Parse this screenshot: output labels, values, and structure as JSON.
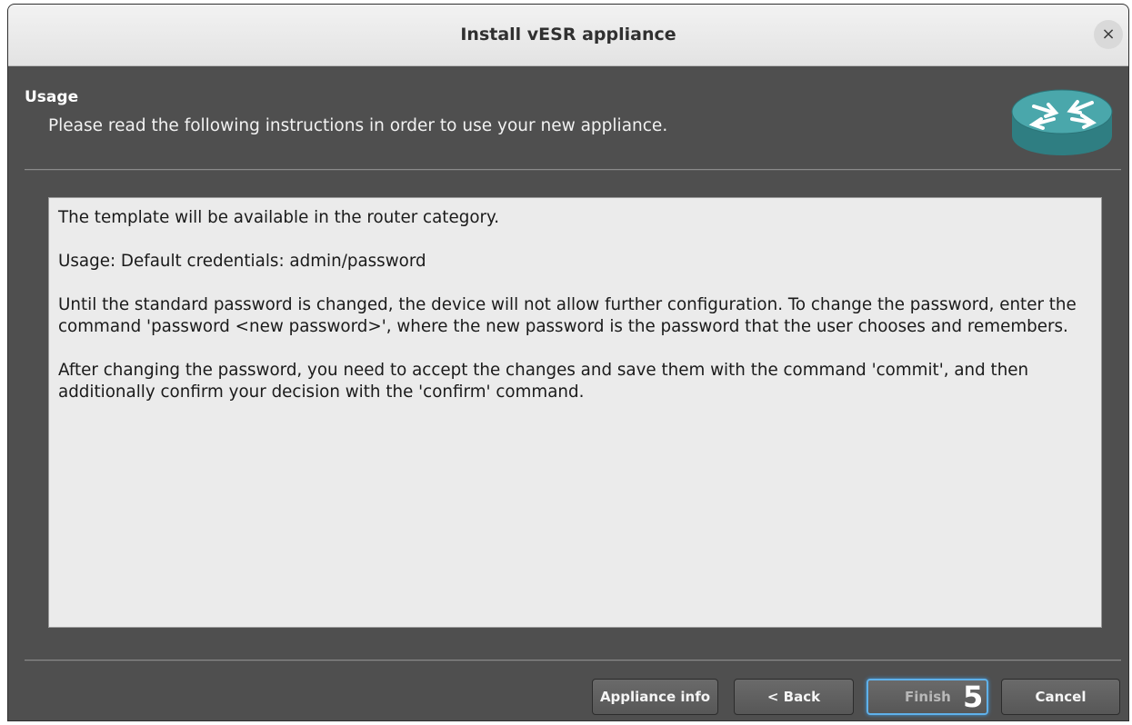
{
  "window": {
    "title": "Install vESR appliance",
    "close_glyph": "×"
  },
  "header": {
    "title": "Usage",
    "subtitle": "Please read the following instructions in order to use your new appliance.",
    "icon": "router-icon"
  },
  "instructions": {
    "paragraphs": [
      "The template will be available in the router category.",
      "Usage: Default credentials: admin/password",
      "Until the standard password is changed, the device will not allow further configuration. To change the password, enter the command 'password <new password>', where the new password is the password that the user chooses and remembers.",
      "After changing the password, you need to accept the changes and save them with the command 'commit', and then additionally confirm your decision with the 'confirm' command."
    ]
  },
  "buttons": {
    "appliance_info": "Appliance info",
    "back": "< Back",
    "finish": "Finish",
    "cancel": "Cancel"
  },
  "annotation": {
    "step_number": "5"
  },
  "colors": {
    "dialog_background": "#4f4f4f",
    "text_area_background": "#ebebeb",
    "focus_ring": "#5fb1ea",
    "router_teal": "#3d9a9e"
  }
}
